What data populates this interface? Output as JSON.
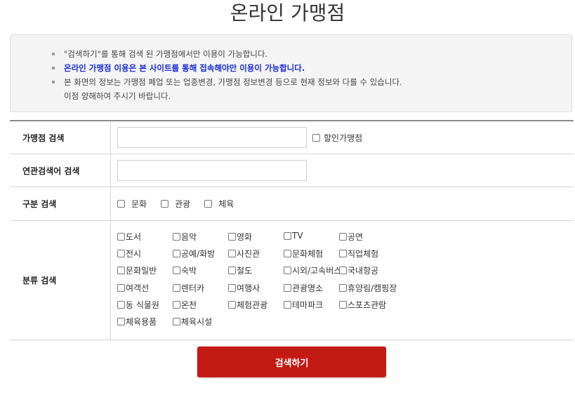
{
  "page_title": "온라인 가맹점",
  "notices": [
    {
      "text": "\"검색하기\"를 통해 검색 된 가맹점에서만 이용이 가능합니다.",
      "emphasis": false
    },
    {
      "text": "온라인 가맹점 이용은 본 사이트를 통해 접속해야만 이용이 가능합니다.",
      "emphasis": true
    },
    {
      "text": "본 화면의 정보는 가맹점 폐업 또는 업종변경, 가맹점 정보변경 등으로 현재 정보와 다를 수 있습니다.",
      "sub": "이점 양해하여 주시기 바랍니다.",
      "emphasis": false
    }
  ],
  "colors": {
    "emphasis": "#1b2fd6",
    "button": "#c41a14",
    "notice_bg": "#f4f4f4"
  },
  "search_form": {
    "merchant_label": "가맹점 검색",
    "merchant_input_value": "",
    "discount_label": "할인가맹점",
    "related_label": "연관검색어 검색",
    "related_input_value": "",
    "type_label": "구분 검색",
    "type_options": [
      "문화",
      "관광",
      "체육"
    ],
    "category_label": "분류 검색",
    "category_rows": [
      [
        "도서",
        "음악",
        "영화",
        "TV",
        "공연"
      ],
      [
        "전시",
        "공예/화방",
        "사진관",
        "문화체험",
        "직업체험"
      ],
      [
        "문화일반",
        "숙박",
        "철도",
        "시외/고속버스",
        "국내항공"
      ],
      [
        "여객선",
        "렌터카",
        "여행사",
        "관광명소",
        "휴양림/캠핑장"
      ],
      [
        "동 식물원",
        "온천",
        "체험관광",
        "테마파크",
        "스포츠관람"
      ],
      [
        "체육용품",
        "체육시설"
      ]
    ],
    "search_button": "검색하기"
  }
}
